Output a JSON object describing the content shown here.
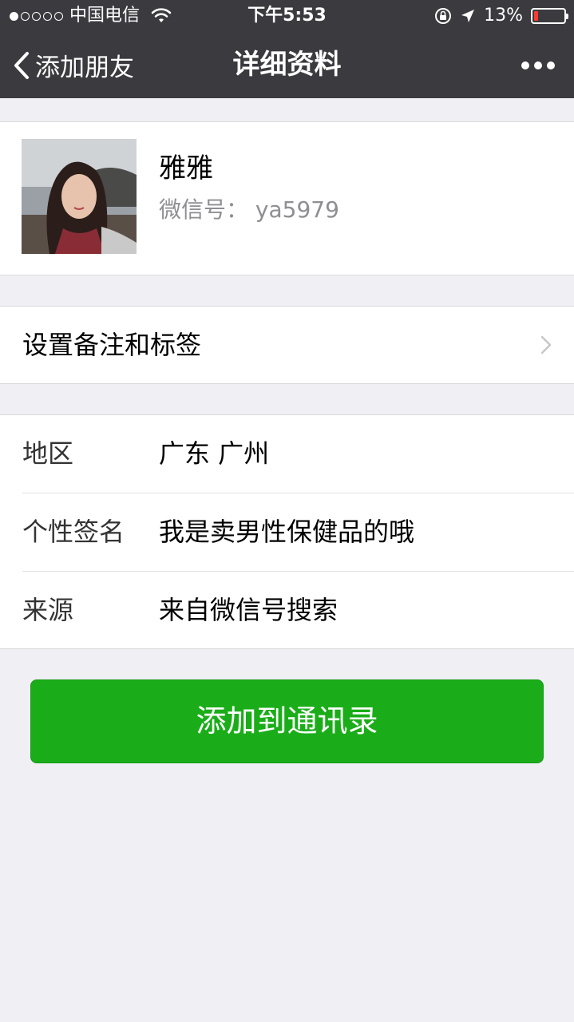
{
  "status_bar": {
    "carrier": "中国电信",
    "time": "下午5:53",
    "battery_text": "13%",
    "battery_level": 0.13,
    "signal_strength": 1
  },
  "nav": {
    "back_label": "添加朋友",
    "title": "详细资料"
  },
  "profile": {
    "name": "雅雅",
    "wechat_id": "微信号：  ya5979"
  },
  "remark": {
    "label": "设置备注和标签"
  },
  "details": [
    {
      "key": "地区",
      "value": "广东  广州"
    },
    {
      "key": "个性签名",
      "value": "我是卖男性保健品的哦"
    },
    {
      "key": "来源",
      "value": "来自微信号搜索"
    }
  ],
  "actions": {
    "add_label": "添加到通讯录"
  },
  "colors": {
    "topbar": "#3a3a3f",
    "background": "#efeff4",
    "primary_button": "#1aad19",
    "battery_low": "#ff3b30"
  },
  "icons": [
    "wifi-icon",
    "rotation-lock-icon",
    "location-arrow-icon",
    "battery-icon",
    "back-chevron-icon",
    "more-icon",
    "chevron-right-icon"
  ]
}
